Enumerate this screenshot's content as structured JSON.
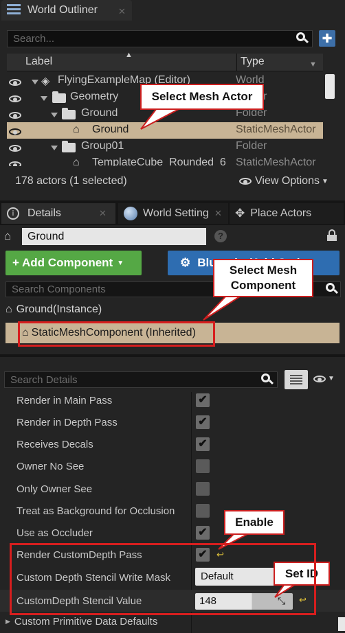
{
  "outliner": {
    "title": "World Outliner",
    "search_placeholder": "Search...",
    "col_label": "Label",
    "col_type": "Type",
    "rows": [
      {
        "label": "FlyingExampleMap (Editor)",
        "type": "World"
      },
      {
        "label": "Geometry",
        "type": "Folder"
      },
      {
        "label": "Ground",
        "type": "Folder"
      },
      {
        "label": "Ground",
        "type": "StaticMeshActor"
      },
      {
        "label": "Group01",
        "type": "Folder"
      },
      {
        "label": "TemplateCube_Rounded_6",
        "type": "StaticMeshActor"
      }
    ],
    "status": "178 actors (1 selected)",
    "view_options": "View Options"
  },
  "tabs": {
    "details": "Details",
    "world_settings": "World Setting",
    "place_actors": "Place Actors"
  },
  "details": {
    "actor_name": "Ground",
    "add_component": "+ Add Component",
    "blueprint_btn": "Blueprint/Add Script",
    "search_components": "Search Components",
    "instance": "Ground(Instance)",
    "component": "StaticMeshComponent (Inherited)",
    "search_details": "Search Details"
  },
  "properties": [
    {
      "label": "Render in Main Pass",
      "checked": true
    },
    {
      "label": "Render in Depth Pass",
      "checked": true
    },
    {
      "label": "Receives Decals",
      "checked": true
    },
    {
      "label": "Owner No See",
      "checked": false
    },
    {
      "label": "Only Owner See",
      "checked": false
    },
    {
      "label": "Treat as Background for Occlusion",
      "checked": false
    },
    {
      "label": "Use as Occluder",
      "checked": true
    },
    {
      "label": "Render CustomDepth Pass",
      "checked": true
    },
    {
      "label": "Custom Depth Stencil Write Mask",
      "value": "Default"
    },
    {
      "label": "CustomDepth Stencil Value",
      "value": "148"
    },
    {
      "label": "Custom Primitive Data Defaults"
    }
  ],
  "check_glyph": "✔",
  "callouts": {
    "select_mesh_actor": "Select Mesh Actor",
    "select_mesh_component": "Select Mesh Component",
    "enable": "Enable",
    "set_id": "Set ID"
  },
  "colors": {
    "selected_row": "#c8b495",
    "add_green": "#55a845",
    "blue_btn": "#2e6db1",
    "annotation_red": "#d71e1e"
  }
}
